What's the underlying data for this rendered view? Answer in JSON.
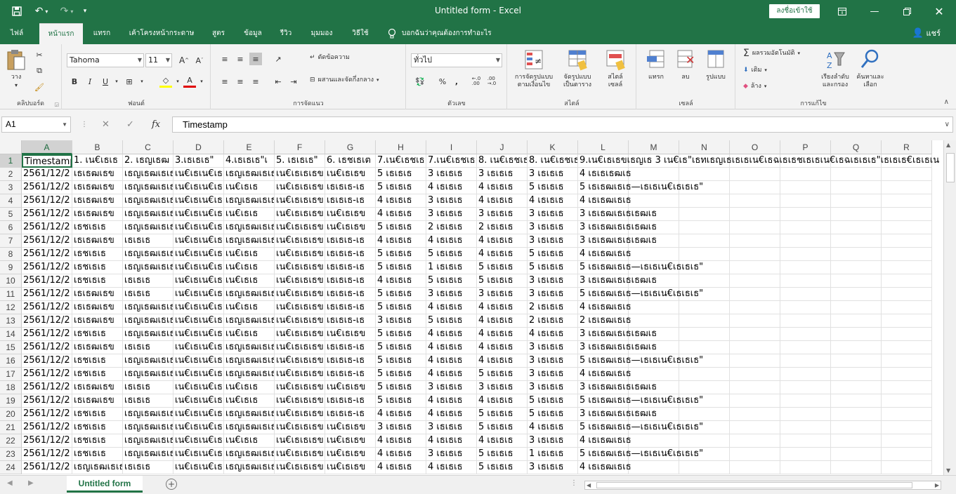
{
  "app": {
    "title": "Untitled form  -  Excel",
    "signin_label": "ลงชื่อเข้าใช้",
    "share_label": "แชร์",
    "tell_me": "บอกฉันว่าคุณต้องการทำอะไร"
  },
  "tabs": [
    "ไฟล์",
    "หน้าแรก",
    "แทรก",
    "เค้าโครงหน้ากระดาษ",
    "สูตร",
    "ข้อมูล",
    "รีวิว",
    "มุมมอง",
    "วิธีใช้"
  ],
  "ribbon": {
    "clipboard": {
      "label": "คลิปบอร์ด",
      "paste": "วาง"
    },
    "font": {
      "label": "ฟอนต์",
      "name": "Tahoma",
      "size": "11"
    },
    "alignment": {
      "label": "การจัดแนว",
      "wrap": "ตัดข้อความ",
      "merge": "ผสานและจัดกึ่งกลาง"
    },
    "number": {
      "label": "ตัวเลข",
      "format": "ทั่วไป"
    },
    "styles": {
      "label": "สไตล์",
      "cond1": "การจัดรูปแบบ",
      "cond2": "ตามเงื่อนไข",
      "tbl1": "จัดรูปแบบ",
      "tbl2": "เป็นตาราง",
      "cell1": "สไตล์",
      "cell2": "เซลล์"
    },
    "cells": {
      "label": "เซลล์",
      "insert": "แทรก",
      "delete": "ลบ",
      "format": "รูปแบบ"
    },
    "editing": {
      "label": "การแก้ไข",
      "autosum": "ผลรวมอัตโนมัติ",
      "fill": "เติม",
      "clear": "ล้าง",
      "sort1": "เรียงลำดับ",
      "sort2": "และกรอง",
      "find1": "ค้นหาและ",
      "find2": "เลือก"
    }
  },
  "formula_bar": {
    "name_box": "A1",
    "fx": "fx",
    "content": "Timestamp"
  },
  "columns": [
    "A",
    "B",
    "C",
    "D",
    "E",
    "F",
    "G",
    "H",
    "I",
    "J",
    "K",
    "L",
    "M",
    "N",
    "O",
    "P",
    "Q",
    "R"
  ],
  "header_row": [
    "Timestamp",
    "1. เน€เธเธ",
    "2. เธญเธฒ",
    "3.เธเธเธ\"",
    "4.เธเธเธ\"เ",
    "5. เธเธเธ\"",
    "6. เธชเธเต",
    "7.เน€เธชเธ",
    "7.เน€เธชเธ",
    "8. เน€เธชเธ",
    "8. เน€เธชเธ",
    "9.เน€เธเธขเธญเธ 3 เน€เธ\"เธทเธญเธเธเธเน€เธฉเธเธชเธเธเน€เธฉเธเธเธ\"เธเธเธ€เธเธเน"
  ],
  "rows": [
    [
      "2561/12/2",
      "เธเธฒเธข",
      "เธญเธฒเธเธ",
      "เน€เธเน€เธ",
      "เธญเธฒเธเธ",
      "เน€เธเธเธข",
      "เน€เธเธข",
      "5 เธเธเธ",
      "3 เธเธเธ",
      "3 เธเธเธ",
      "3 เธเธเธ",
      "4 เธเธเธฒเธ",
      ""
    ],
    [
      "2561/12/2",
      "เธเธฒเธข",
      "เธญเธฒเธเธ",
      "เน€เธเน€เธ",
      "เน€เธเธ",
      "เน€เธเธเธข",
      "เธเธเธ-เธ",
      "5 เธเธเธ",
      "4 เธเธเธ",
      "4 เธเธเธ",
      "5 เธเธเธ",
      "5 เธเธฒเธเธ—เธเธเน€เธเธเธ\"",
      ""
    ],
    [
      "2561/12/2",
      "เธเธฒเธข",
      "เธญเธฒเธเธ",
      "เน€เธเน€เธ",
      "เธญเธฒเธเธ",
      "เน€เธเธเธข",
      "เธเธเธ-เธ",
      "4 เธเธเธ",
      "3 เธเธเธ",
      "4 เธเธเธ",
      "4 เธเธเธ",
      "4 เธเธฒเธเธ",
      ""
    ],
    [
      "2561/12/2",
      "เธเธฒเธข",
      "เธญเธฒเธเธ",
      "เน€เธเน€เธ",
      "เน€เธเธ",
      "เน€เธเธเธข",
      "เน€เธเธข",
      "4 เธเธเธ",
      "3 เธเธเธ",
      "3 เธเธเธ",
      "3 เธเธเธ",
      "3 เธเธฒเธเธเธฒเธ",
      ""
    ],
    [
      "2561/12/2",
      "เธชเธเธ",
      "เธญเธฒเธเธ",
      "เน€เธเน€เธ",
      "เธญเธฒเธเธ",
      "เน€เธเธเธข",
      "เน€เธเธข",
      "5 เธเธเธ",
      "2 เธเธเธ",
      "2 เธเธเธ",
      "3 เธเธเธ",
      "3 เธเธฒเธเธเธฒเธ",
      ""
    ],
    [
      "2561/12/2",
      "เธเธฒเธข",
      "เธเธเธ",
      "เน€เธเน€เธ",
      "เธญเธฒเธเธ",
      "เน€เธเธเธข",
      "เธเธเธ-เธ",
      "4 เธเธเธ",
      "4 เธเธเธ",
      "4 เธเธเธ",
      "3 เธเธเธ",
      "3 เธเธฒเธเธเธฒเธ",
      ""
    ],
    [
      "2561/12/2",
      "เธชเธเธ",
      "เธญเธฒเธเธ",
      "เน€เธเน€เธ",
      "เน€เธเธ",
      "เน€เธเธเธข",
      "เธเธเธ-เธ",
      "5 เธเธเธ",
      "5 เธเธเธ",
      "4 เธเธเธ",
      "5 เธเธเธ",
      "4 เธเธฒเธเธ",
      ""
    ],
    [
      "2561/12/2",
      "เธชเธเธ",
      "เธญเธฒเธเธ",
      "เน€เธเน€เธ",
      "เน€เธเธ",
      "เน€เธเธเธข",
      "เธเธเธ-เธ",
      "5 เธเธเธ",
      "1 เธเธเธ",
      "5 เธเธเธ",
      "5 เธเธเธ",
      "5 เธเธฒเธเธ—เธเธเน€เธเธเธ\"",
      ""
    ],
    [
      "2561/12/2",
      "เธชเธเธ",
      "เธเธเธ",
      "เน€เธเน€เธ",
      "เน€เธเธ",
      "เน€เธเธเธข",
      "เธเธเธ-เธ",
      "4 เธเธเธ",
      "5 เธเธเธ",
      "5 เธเธเธ",
      "3 เธเธเธ",
      "3 เธเธฒเธเธเธฒเธ",
      ""
    ],
    [
      "2561/12/2",
      "เธเธฒเธข",
      "เธเธเธ",
      "เน€เธเน€เธ",
      "เธญเธฒเธเธ",
      "เน€เธเธเธข",
      "เธเธเธ-เธ",
      "5 เธเธเธ",
      "3 เธเธเธ",
      "3 เธเธเธ",
      "3 เธเธเธ",
      "5 เธเธฒเธเธ—เธเธเน€เธเธเธ\"",
      ""
    ],
    [
      "2561/12/2",
      "เธเธฒเธข",
      "เธญเธฒเธเธ",
      "เน€เธเน€เธ",
      "เน€เธเธ",
      "เน€เธเธเธข",
      "เธเธเธ-เธ",
      "5 เธเธเธ",
      "4 เธเธเธ",
      "4 เธเธเธ",
      "2 เธเธเธ",
      "4 เธเธฒเธเธ",
      ""
    ],
    [
      "2561/12/2",
      "เธเธฒเธข",
      "เธญเธฒเธเธ",
      "เน€เธเน€เธ",
      "เธญเธฒเธเธ",
      "เน€เธเธเธข",
      "เธเธเธ-เธ",
      "3 เธเธเธ",
      "5 เธเธเธ",
      "4 เธเธเธ",
      "2 เธเธเธ",
      "2 เธเธฒเธเธ",
      ""
    ],
    [
      "2561/12/2",
      "เธชเธเธ",
      "เธญเธฒเธเธ",
      "เน€เธเน€เธ",
      "เน€เธเธ",
      "เน€เธเธเธข",
      "เน€เธเธข",
      "5 เธเธเธ",
      "4 เธเธเธ",
      "4 เธเธเธ",
      "4 เธเธเธ",
      "3 เธเธฒเธเธเธฒเธ",
      ""
    ],
    [
      "2561/12/2",
      "เธเธฒเธข",
      "เธเธเธ",
      "เน€เธเน€เธ",
      "เธญเธฒเธเธ",
      "เน€เธเธเธข",
      "เธเธเธ-เธ",
      "5 เธเธเธ",
      "4 เธเธเธ",
      "4 เธเธเธ",
      "3 เธเธเธ",
      "3 เธเธฒเธเธเธฒเธ",
      ""
    ],
    [
      "2561/12/2",
      "เธชเธเธ",
      "เธญเธฒเธเธ",
      "เน€เธเน€เธ",
      "เธญเธฒเธเธ",
      "เน€เธเธเธข",
      "เธเธเธ-เธ",
      "5 เธเธเธ",
      "4 เธเธเธ",
      "4 เธเธเธ",
      "3 เธเธเธ",
      "5 เธเธฒเธเธ—เธเธเน€เธเธเธ\"",
      ""
    ],
    [
      "2561/12/2",
      "เธชเธเธ",
      "เธญเธฒเธเธ",
      "เน€เธเน€เธ",
      "เธญเธฒเธเธ",
      "เน€เธเธเธข",
      "เธเธเธ-เธ",
      "5 เธเธเธ",
      "4 เธเธเธ",
      "5 เธเธเธ",
      "3 เธเธเธ",
      "4 เธเธฒเธเธ",
      ""
    ],
    [
      "2561/12/2",
      "เธเธฒเธข",
      "เธเธเธ",
      "เน€เธเน€เธ",
      "เน€เธเธ",
      "เน€เธเธเธข",
      "เน€เธเธข",
      "5 เธเธเธ",
      "3 เธเธเธ",
      "3 เธเธเธ",
      "3 เธเธเธ",
      "3 เธเธฒเธเธเธฒเธ",
      ""
    ],
    [
      "2561/12/2",
      "เธเธฒเธข",
      "เธเธเธ",
      "เน€เธเน€เธ",
      "เน€เธเธ",
      "เน€เธเธเธข",
      "เธเธเธ-เธ",
      "5 เธเธเธ",
      "4 เธเธเธ",
      "4 เธเธเธ",
      "5 เธเธเธ",
      "5 เธเธฒเธเธ—เธเธเน€เธเธเธ\"",
      ""
    ],
    [
      "2561/12/2",
      "เธชเธเธ",
      "เธญเธฒเธเธ",
      "เน€เธเน€เธ",
      "เธญเธฒเธเธ",
      "เน€เธเธเธข",
      "เธเธเธ-เธ",
      "4 เธเธเธ",
      "4 เธเธเธ",
      "5 เธเธเธ",
      "5 เธเธเธ",
      "3 เธเธฒเธเธเธฒเธ",
      ""
    ],
    [
      "2561/12/2",
      "เธชเธเธ",
      "เธญเธฒเธเธ",
      "เน€เธเน€เธ",
      "เธญเธฒเธเธ",
      "เน€เธเธเธข",
      "เน€เธเธข",
      "3 เธเธเธ",
      "3 เธเธเธ",
      "5 เธเธเธ",
      "4 เธเธเธ",
      "5 เธเธฒเธเธ—เธเธเน€เธเธเธ\"",
      ""
    ],
    [
      "2561/12/2",
      "เธชเธเธ",
      "เธญเธฒเธเธ",
      "เน€เธเน€เธ",
      "เน€เธเธ",
      "เน€เธเธเธข",
      "เน€เธเธข",
      "4 เธเธเธ",
      "4 เธเธเธ",
      "4 เธเธเธ",
      "3 เธเธเธ",
      "4 เธเธฒเธเธ",
      ""
    ],
    [
      "2561/12/2",
      "เธชเธเธ",
      "เธญเธฒเธเธ",
      "เน€เธเน€เธ",
      "เธญเธฒเธเธ",
      "เน€เธเธเธข",
      "เน€เธเธข",
      "4 เธเธเธ",
      "3 เธเธเธ",
      "5 เธเธเธ",
      "1 เธเธเธ",
      "5 เธเธฒเธเธ—เธเธเน€เธเธเธ\"",
      ""
    ],
    [
      "2561/12/2",
      "เธญเธฒเธเธ",
      "เธเธเธ",
      "เน€เธเน€เธ",
      "เธญเธฒเธเธ",
      "เน€เธเธเธข",
      "เน€เธเธข",
      "4 เธเธเธ",
      "4 เธเธเธ",
      "5 เธเธเธ",
      "3 เธเธเธ",
      "4 เธเธฒเธเธ",
      ""
    ]
  ],
  "sheet": {
    "name": "Untitled form"
  },
  "colors": {
    "accent": "#217346",
    "ribbon_bg": "#f3f3f3"
  }
}
